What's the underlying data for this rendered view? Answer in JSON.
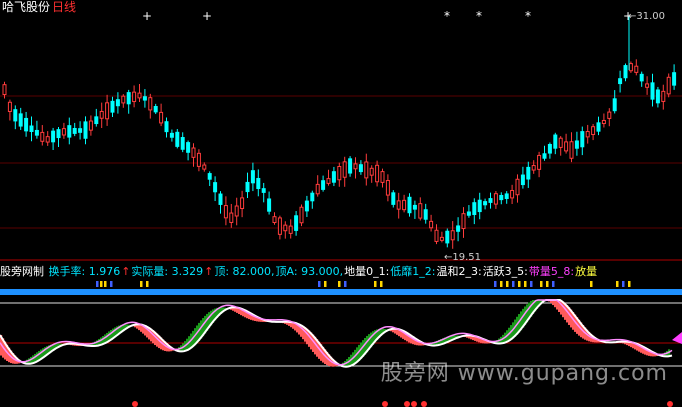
{
  "header": {
    "stock_name": "哈飞股份",
    "period": "日线"
  },
  "price_labels": {
    "high": "31.00",
    "low": "19.51"
  },
  "indicator": {
    "name": "股旁网制",
    "items": [
      {
        "label": "换手率:",
        "value": "1.976",
        "arrow": "↑",
        "color": "#00e5ff"
      },
      {
        "label": "实际量:",
        "value": "3.329",
        "arrow": "↑",
        "color": "#00e5ff"
      },
      {
        "label": "顶:",
        "value": "82.000,",
        "arrow": "",
        "color": "#00e5ff"
      },
      {
        "label": "顶A:",
        "value": "93.000,",
        "arrow": "",
        "color": "#00e5ff"
      },
      {
        "label": "地量0_1:",
        "value": "",
        "arrow": "",
        "color": "#ffffff"
      },
      {
        "label": "低靡1_2:",
        "value": "",
        "arrow": "",
        "color": "#00e5ff"
      },
      {
        "label": "温和2_3:",
        "value": "",
        "arrow": "",
        "color": "#ffffff"
      },
      {
        "label": "活跃3_5:",
        "value": "",
        "arrow": "",
        "color": "#ffffff"
      },
      {
        "label": "带量5_8:",
        "value": "",
        "arrow": "",
        "color": "#ff40ff"
      },
      {
        "label": "放量",
        "value": "",
        "arrow": "",
        "color": "#ffff40"
      }
    ]
  },
  "watermark": "股旁网 www.gupang.com",
  "colors": {
    "up": "#ff3c3c",
    "down": "#00ffff",
    "header_period": "#ff3030"
  }
}
